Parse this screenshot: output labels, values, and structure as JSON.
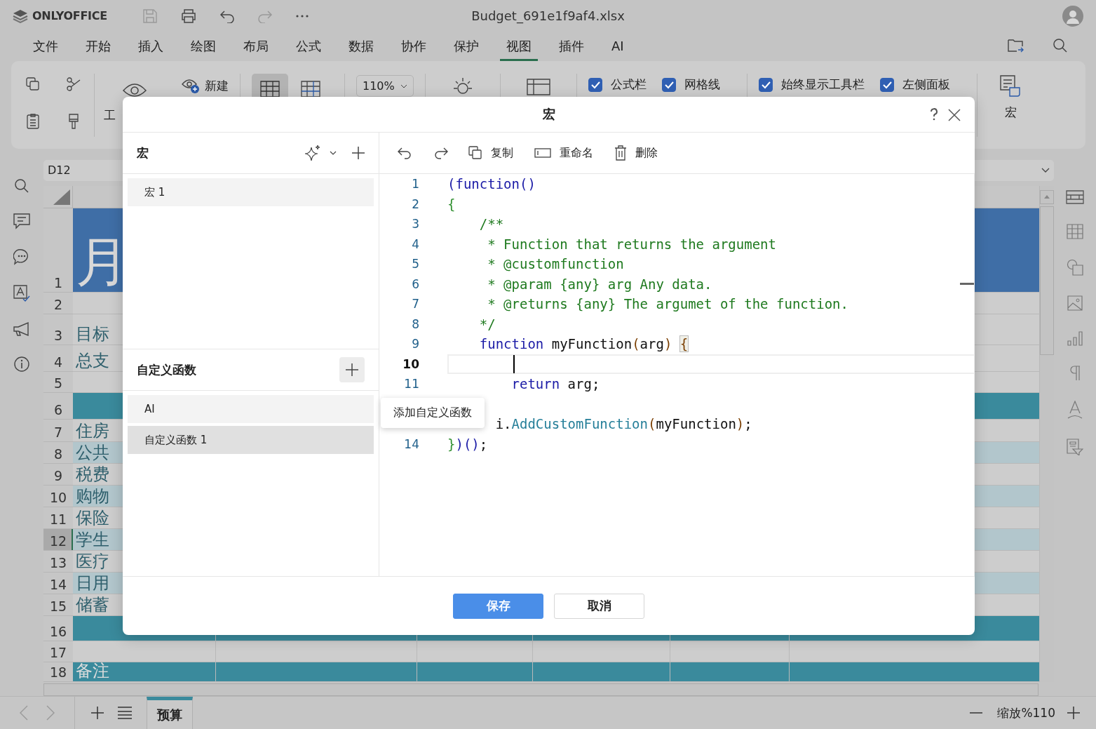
{
  "app": {
    "logo": "ONLYOFFICE",
    "title": "Budget_691e1f9af4.xlsx"
  },
  "menu": [
    {
      "label": "文件",
      "selected": false
    },
    {
      "label": "开始",
      "selected": false
    },
    {
      "label": "插入",
      "selected": false
    },
    {
      "label": "绘图",
      "selected": false
    },
    {
      "label": "布局",
      "selected": false
    },
    {
      "label": "公式",
      "selected": false
    },
    {
      "label": "数据",
      "selected": false
    },
    {
      "label": "协作",
      "selected": false
    },
    {
      "label": "保护",
      "selected": false
    },
    {
      "label": "视图",
      "selected": true
    },
    {
      "label": "插件",
      "selected": false
    },
    {
      "label": "AI",
      "selected": false
    }
  ],
  "toolbar": {
    "partial_label": "工",
    "new_label": "新建",
    "zoom": "110%",
    "checkboxes": [
      {
        "label": "公式栏",
        "checked": true
      },
      {
        "label": "网格线",
        "checked": true
      },
      {
        "label": "始终显示工具栏",
        "checked": true
      },
      {
        "label": "左侧面板",
        "checked": true
      }
    ],
    "macro_label": "宏"
  },
  "formula_bar": {
    "cell": "D12"
  },
  "sheet": {
    "rows": [
      {
        "number": "1",
        "kind": "title",
        "selected": false,
        "text": "月"
      },
      {
        "number": "2",
        "kind": "plain",
        "selected": false
      },
      {
        "number": "3",
        "kind": "plain",
        "selected": false,
        "text": "目标"
      },
      {
        "number": "4",
        "kind": "plain",
        "selected": false,
        "text": "总支"
      },
      {
        "number": "5",
        "kind": "plain",
        "selected": false
      },
      {
        "number": "6",
        "kind": "band",
        "selected": false
      },
      {
        "number": "7",
        "kind": "plain",
        "selected": false,
        "text": "住房"
      },
      {
        "number": "8",
        "kind": "alt",
        "selected": false,
        "text": "公共"
      },
      {
        "number": "9",
        "kind": "plain",
        "selected": false,
        "text": "税费"
      },
      {
        "number": "10",
        "kind": "alt",
        "selected": false,
        "text": "购物"
      },
      {
        "number": "11",
        "kind": "plain",
        "selected": false,
        "text": "保险"
      },
      {
        "number": "12",
        "kind": "alt",
        "selected": true,
        "text": "学生"
      },
      {
        "number": "13",
        "kind": "plain",
        "selected": false,
        "text": "医疗"
      },
      {
        "number": "14",
        "kind": "alt",
        "selected": false,
        "text": "日用"
      },
      {
        "number": "15",
        "kind": "plain",
        "selected": false,
        "text": "储蓄"
      },
      {
        "number": "16",
        "kind": "band",
        "selected": false
      },
      {
        "number": "17",
        "kind": "plain",
        "selected": false
      },
      {
        "number": "18",
        "kind": "band",
        "selected": false,
        "text": "备注"
      }
    ]
  },
  "sheet_tabs": [
    {
      "label": "预算",
      "selected": true
    }
  ],
  "status": {
    "zoom": "缩放%110"
  },
  "dialog": {
    "title": "宏",
    "macros": {
      "heading": "宏",
      "items": [
        {
          "label": "宏 1",
          "selected": false
        }
      ]
    },
    "functions": {
      "heading": "自定义函数",
      "items": [
        {
          "label": "AI",
          "selected": false
        },
        {
          "label": "自定义函数 1",
          "selected": true
        }
      ]
    },
    "actions": [
      {
        "kind": "copy",
        "label": "复制"
      },
      {
        "kind": "rename",
        "label": "重命名"
      },
      {
        "kind": "delete",
        "label": "删除"
      }
    ],
    "code": [
      {
        "number": "1",
        "current": false,
        "tokens": [
          {
            "text": "(function()",
            "kind": "keyword"
          }
        ]
      },
      {
        "number": "2",
        "current": false,
        "tokens": [
          {
            "text": "{",
            "kind": "brace"
          }
        ]
      },
      {
        "number": "3",
        "current": false,
        "tokens": [
          {
            "text": "    /**",
            "kind": "comment"
          }
        ]
      },
      {
        "number": "4",
        "current": false,
        "tokens": [
          {
            "text": "     * Function that returns the argument",
            "kind": "comment"
          }
        ]
      },
      {
        "number": "5",
        "current": false,
        "tokens": [
          {
            "text": "     * @customfunction",
            "kind": "comment"
          }
        ]
      },
      {
        "number": "6",
        "current": false,
        "tokens": [
          {
            "text": "     * @param {any} arg Any data.",
            "kind": "comment"
          }
        ]
      },
      {
        "number": "7",
        "current": false,
        "tokens": [
          {
            "text": "     * @returns {any} The argumet of the function.",
            "kind": "comment"
          }
        ]
      },
      {
        "number": "8",
        "current": false,
        "tokens": [
          {
            "text": "    */",
            "kind": "comment"
          }
        ]
      },
      {
        "number": "9",
        "current": false,
        "tokens": [
          {
            "text": "    function",
            "kind": "keyword"
          },
          {
            "text": " myFunction",
            "kind": "plain"
          },
          {
            "text": "(",
            "kind": "paren"
          },
          {
            "text": "arg",
            "kind": "plain"
          },
          {
            "text": ") ",
            "kind": "paren"
          },
          {
            "text": "{",
            "kind": "match"
          }
        ]
      },
      {
        "number": "10",
        "current": true
      },
      {
        "number": "11",
        "current": false,
        "tokens": [
          {
            "text": "        return",
            "kind": "keyword"
          },
          {
            "text": " arg;",
            "kind": "plain"
          }
        ]
      },
      {
        "current": false
      },
      {
        "current": false,
        "tokens": [
          {
            "text": "      i.",
            "kind": "plain"
          },
          {
            "text": "AddCustomFunction",
            "kind": "method"
          },
          {
            "text": "(",
            "kind": "paren"
          },
          {
            "text": "myFunction",
            "kind": "plain"
          },
          {
            "text": ")",
            "kind": "paren"
          },
          {
            "text": ";",
            "kind": "plain"
          }
        ]
      },
      {
        "number": "14",
        "current": false,
        "tokens": [
          {
            "text": "}",
            "kind": "brace"
          },
          {
            "text": ")()",
            "kind": "keyword"
          },
          {
            "text": ";",
            "kind": "plain"
          }
        ]
      }
    ],
    "tooltip": "添加自定义函数",
    "buttons": [
      {
        "label": "保存",
        "kind": "primary"
      },
      {
        "label": "取消",
        "kind": "secondary"
      }
    ]
  }
}
